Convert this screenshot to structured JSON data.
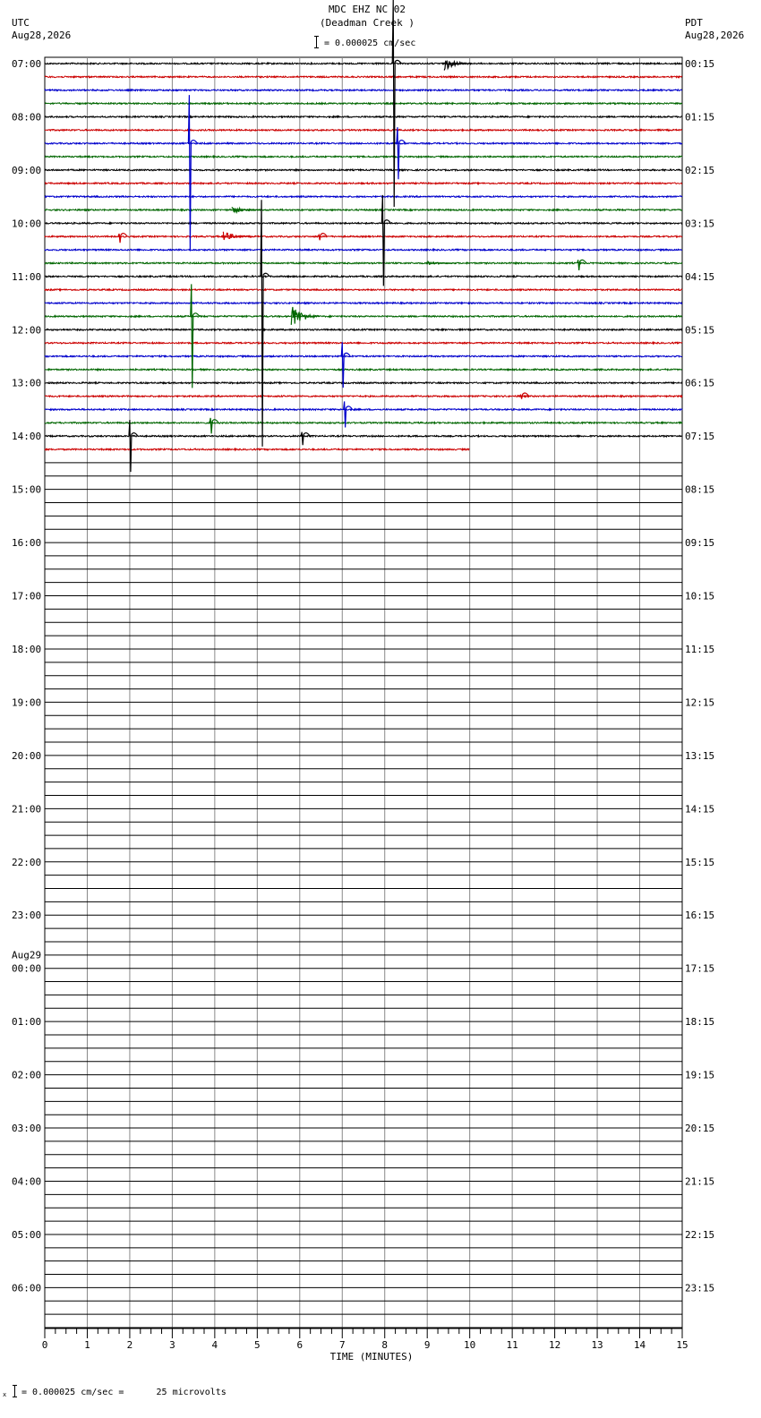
{
  "header": {
    "station_line": "MDC EHZ NC 02",
    "station_name": "(Deadman Creek )",
    "scale_text": "= 0.000025 cm/sec",
    "left_tz": "UTC",
    "left_date": "Aug28,2026",
    "right_tz": "PDT",
    "right_date": "Aug28,2026"
  },
  "footer": {
    "calibration_text": "= 0.000025 cm/sec =      25 microvolts"
  },
  "chart_data": {
    "type": "line",
    "title": "MDC EHZ NC 02 (Deadman Creek )",
    "xlabel": "TIME (MINUTES)",
    "xlim": [
      0,
      15
    ],
    "x_ticks": [
      "0",
      "1",
      "2",
      "3",
      "4",
      "5",
      "6",
      "7",
      "8",
      "9",
      "10",
      "11",
      "12",
      "13",
      "14",
      "15"
    ],
    "trace_minutes_per_line": 15,
    "traces_per_hour": 4,
    "total_lines": 96,
    "recorded_lines": 30,
    "last_line_end_minute": 10,
    "trace_colors": [
      "#000000",
      "#cc0000",
      "#0000cc",
      "#006600"
    ],
    "grid": true,
    "left_labels": [
      "07:00",
      "08:00",
      "09:00",
      "10:00",
      "11:00",
      "12:00",
      "13:00",
      "14:00",
      "15:00",
      "16:00",
      "17:00",
      "18:00",
      "19:00",
      "20:00",
      "21:00",
      "22:00",
      "23:00",
      "Aug29",
      "00:00",
      "01:00",
      "02:00",
      "03:00",
      "04:00",
      "05:00",
      "06:00"
    ],
    "right_labels": [
      "00:15",
      "01:15",
      "02:15",
      "03:15",
      "04:15",
      "05:15",
      "06:15",
      "07:15",
      "08:15",
      "09:15",
      "10:15",
      "11:15",
      "12:15",
      "13:15",
      "14:15",
      "15:15",
      "16:15",
      "17:15",
      "18:15",
      "19:15",
      "20:15",
      "21:15",
      "22:15",
      "23:15"
    ],
    "events": [
      {
        "line": 0,
        "minute": 9.4,
        "amp": 8,
        "kind": "quake"
      },
      {
        "line": 0,
        "minute": 8.2,
        "amp": 160,
        "kind": "spike"
      },
      {
        "line": 6,
        "minute": 3.4,
        "amp": 120,
        "kind": "spike"
      },
      {
        "line": 6,
        "minute": 8.3,
        "amp": 40,
        "kind": "spike"
      },
      {
        "line": 11,
        "minute": 4.4,
        "amp": 4,
        "kind": "quake"
      },
      {
        "line": 12,
        "minute": 7.95,
        "amp": 70,
        "kind": "spike"
      },
      {
        "line": 13,
        "minute": 1.75,
        "amp": 7,
        "kind": "spike"
      },
      {
        "line": 13,
        "minute": 4.2,
        "amp": 6,
        "kind": "quake"
      },
      {
        "line": 13,
        "minute": 6.45,
        "amp": 4,
        "kind": "spike"
      },
      {
        "line": 15,
        "minute": 12.55,
        "amp": 8,
        "kind": "spike"
      },
      {
        "line": 15,
        "minute": 9.0,
        "amp": 2,
        "kind": "quake"
      },
      {
        "line": 16,
        "minute": 5.1,
        "amp": 190,
        "kind": "spike"
      },
      {
        "line": 19,
        "minute": 5.8,
        "amp": 14,
        "kind": "quake"
      },
      {
        "line": 19,
        "minute": 3.45,
        "amp": 80,
        "kind": "spike"
      },
      {
        "line": 22,
        "minute": 7.0,
        "amp": 35,
        "kind": "spike"
      },
      {
        "line": 25,
        "minute": 11.2,
        "amp": 3,
        "kind": "spike"
      },
      {
        "line": 26,
        "minute": 7.05,
        "amp": 20,
        "kind": "spike"
      },
      {
        "line": 27,
        "minute": 3.9,
        "amp": 12,
        "kind": "spike"
      },
      {
        "line": 28,
        "minute": 2.0,
        "amp": 40,
        "kind": "spike"
      },
      {
        "line": 28,
        "minute": 6.05,
        "amp": 10,
        "kind": "spike"
      }
    ]
  }
}
